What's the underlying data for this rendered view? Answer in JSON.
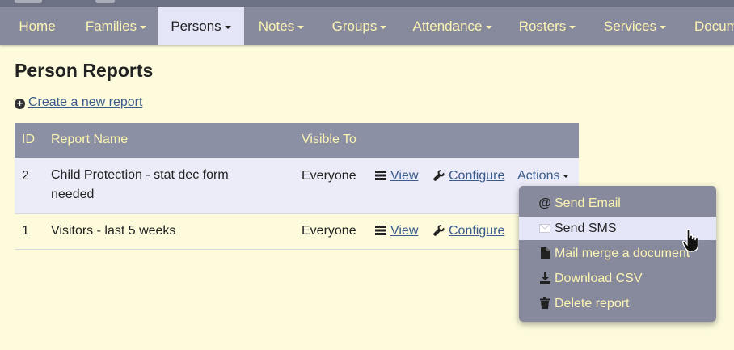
{
  "nav": {
    "items": [
      {
        "label": "Home",
        "dropdown": false
      },
      {
        "label": "Families",
        "dropdown": true
      },
      {
        "label": "Persons",
        "dropdown": true,
        "active": true
      },
      {
        "label": "Notes",
        "dropdown": true
      },
      {
        "label": "Groups",
        "dropdown": true
      },
      {
        "label": "Attendance",
        "dropdown": true
      },
      {
        "label": "Rosters",
        "dropdown": true
      },
      {
        "label": "Services",
        "dropdown": true
      },
      {
        "label": "Docum",
        "dropdown": false
      }
    ]
  },
  "page": {
    "title": "Person Reports",
    "create_link": "Create a new report"
  },
  "table": {
    "headers": {
      "id": "ID",
      "name": "Report Name",
      "visible": "Visible To"
    },
    "rows": [
      {
        "id": "2",
        "name": "Child Protection - stat dec form needed",
        "visible": "Everyone",
        "view": "View",
        "configure": "Configure",
        "actions": "Actions"
      },
      {
        "id": "1",
        "name": "Visitors - last 5 weeks",
        "visible": "Everyone",
        "view": "View",
        "configure": "Configure"
      }
    ]
  },
  "dropdown": {
    "items": [
      {
        "label": "Send Email",
        "icon": "at-icon"
      },
      {
        "label": "Send SMS",
        "icon": "envelope-icon",
        "hover": true
      },
      {
        "label": "Mail merge a document",
        "icon": "file-icon"
      },
      {
        "label": "Download CSV",
        "icon": "download-icon"
      },
      {
        "label": "Delete report",
        "icon": "trash-icon"
      }
    ]
  },
  "colors": {
    "background": "#fdfbdc",
    "nav_bg": "#878a9c",
    "nav_text": "#fbf3b3",
    "link": "#3a5b8c"
  }
}
